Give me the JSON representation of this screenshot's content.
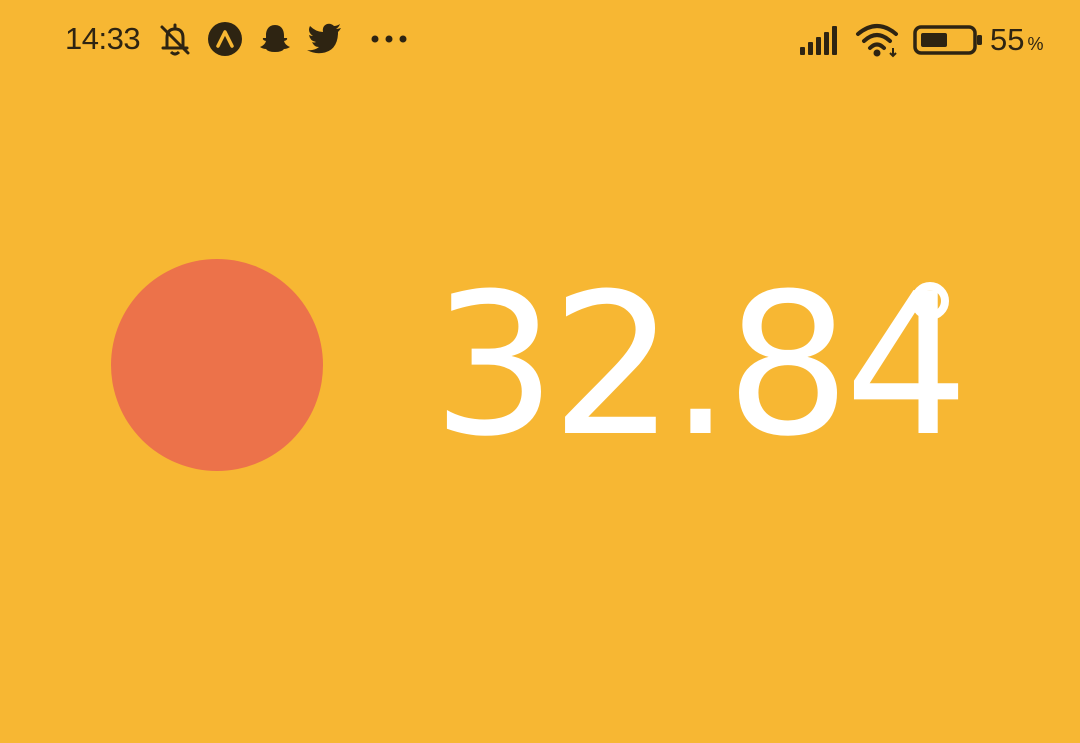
{
  "status_bar": {
    "time": "14:33",
    "notification_icons": [
      "bell-off-icon",
      "app-circle-icon",
      "snapchat-ghost-icon",
      "twitter-bird-icon",
      "more-dots-icon"
    ],
    "system_icons": [
      "signal-bars-icon",
      "wifi-icon",
      "battery-icon"
    ],
    "battery_level": 55,
    "battery_value": "55",
    "battery_unit": "%"
  },
  "main": {
    "temperature_value": "32.84",
    "degree_unit": "°",
    "indicator_color": "#EC724A"
  },
  "theme": {
    "background": "#F7B733",
    "foreground": "#FFFFFF",
    "statusbar_foreground": "#2E2412"
  }
}
